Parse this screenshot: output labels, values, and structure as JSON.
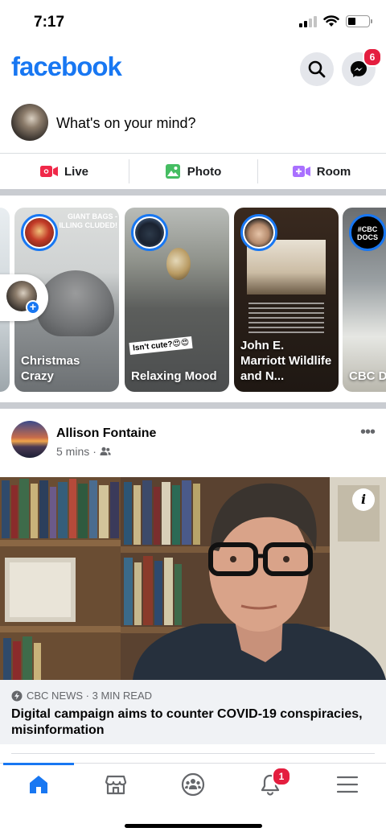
{
  "status": {
    "time": "7:17"
  },
  "header": {
    "logo": "facebook",
    "messenger_badge": "6",
    "search_icon": "search-icon",
    "messenger_icon": "messenger-icon"
  },
  "composer": {
    "placeholder": "What's on your mind?"
  },
  "actions": [
    {
      "label": "Live",
      "icon": "live-video-icon",
      "color": "#f02849"
    },
    {
      "label": "Photo",
      "icon": "photo-icon",
      "color": "#45bd62"
    },
    {
      "label": "Room",
      "icon": "room-icon",
      "color": "#a970ff"
    }
  ],
  "stories": {
    "items": [
      {
        "name": "Christmas Crazy",
        "overlay_text": "GIANT BAGS - ILLING CLUDED!"
      },
      {
        "name": "Relaxing Mood",
        "sticker": "Isn't cute?😍😍"
      },
      {
        "name": "John E. Marriott Wildlife and N..."
      },
      {
        "name": "CBC D",
        "ring_label": "#CBC DOCS"
      }
    ]
  },
  "post": {
    "author": "Allison Fontaine",
    "time": "5 mins",
    "audience_icon": "friends-icon",
    "link_source": "CBC NEWS · 3 MIN READ",
    "link_title": "Digital campaign aims to counter COVID-19 conspiracies, misinformation"
  },
  "bottom_nav": {
    "items": [
      "home-icon",
      "marketplace-icon",
      "groups-icon",
      "notifications-icon",
      "menu-icon"
    ],
    "notifications_badge": "1",
    "active": "home-icon"
  },
  "colors": {
    "brand": "#1877f2",
    "badge": "#e41e3f"
  }
}
